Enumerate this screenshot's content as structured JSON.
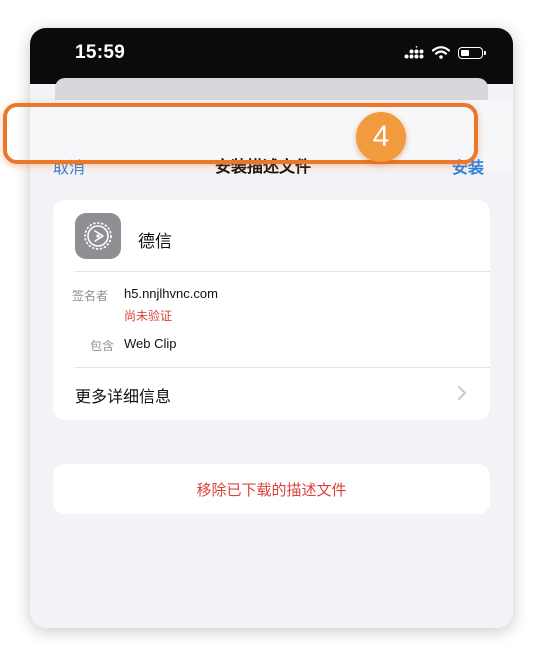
{
  "status_bar": {
    "time": "15:59"
  },
  "nav": {
    "cancel_label": "取消",
    "title": "安装描述文件",
    "install_label": "安装"
  },
  "step_badge": "4",
  "profile": {
    "name": "德信",
    "signer_label": "签名者",
    "signer_value": "h5.nnjlhvnc.com",
    "verify_status": "尚未验证",
    "contains_label": "包含",
    "contains_value": "Web Clip",
    "more_details_label": "更多详细信息"
  },
  "remove_label": "移除已下载的描述文件",
  "colors": {
    "accent": "#2f7fe0",
    "destructive": "#d9433a",
    "highlight": "#e9782d",
    "badge": "#f19a3e"
  },
  "icons": [
    "signal-icon",
    "wifi-icon",
    "battery-icon",
    "settings-gear-icon",
    "chevron-right-icon"
  ]
}
